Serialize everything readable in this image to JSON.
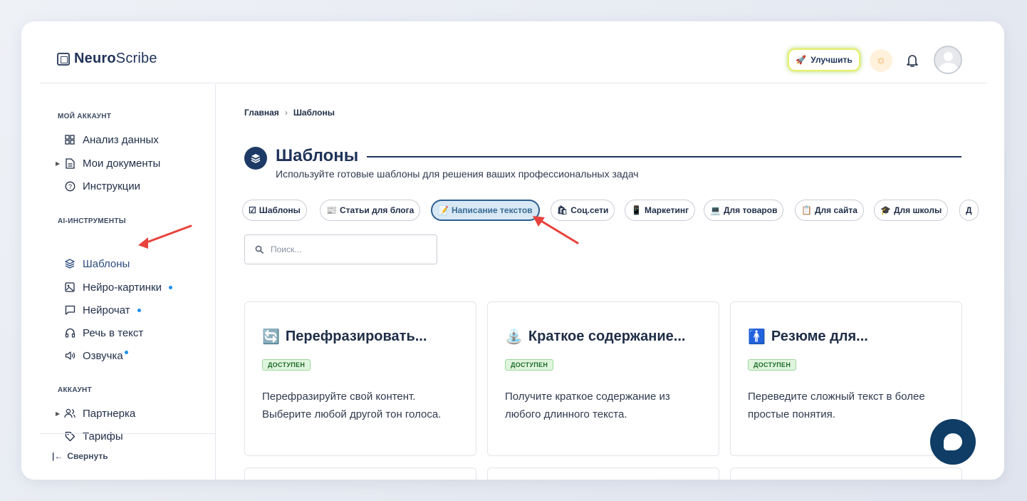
{
  "brand": {
    "name_bold": "Neuro",
    "name_rest": "Scribe"
  },
  "header": {
    "upgrade_label": "Улучшить"
  },
  "sidebar": {
    "sections": [
      {
        "title": "МОЙ АККАУНТ"
      },
      {
        "title": "AI-ИНСТРУМЕНТЫ"
      },
      {
        "title": "АККАУНТ"
      }
    ],
    "items": [
      {
        "label": "Анализ данных",
        "icon": "grid-icon"
      },
      {
        "label": "Мои документы",
        "icon": "document-icon"
      },
      {
        "label": "Инструкции",
        "icon": "help-circle-icon"
      },
      {
        "label": "Шаблоны",
        "icon": "layers-icon"
      },
      {
        "label": "Нейро-картинки",
        "icon": "image-icon"
      },
      {
        "label": "Нейрочат",
        "icon": "chat-icon"
      },
      {
        "label": "Речь в текст",
        "icon": "headphones-icon"
      },
      {
        "label": "Озвучка",
        "icon": "speaker-icon"
      },
      {
        "label": "Партнерка",
        "icon": "users-icon"
      },
      {
        "label": "Тарифы",
        "icon": "tag-icon"
      }
    ],
    "collapse_label": "Свернуть"
  },
  "breadcrumb": {
    "home": "Главная",
    "current": "Шаблоны"
  },
  "page": {
    "title": "Шаблоны",
    "subtitle": "Используйте готовые шаблоны для решения ваших профессиональных задач"
  },
  "chips": [
    {
      "emoji": "☑",
      "label": "Шаблоны"
    },
    {
      "emoji": "📰",
      "label": "Статьи для блога"
    },
    {
      "emoji": "📝",
      "label": "Написание текстов"
    },
    {
      "emoji": "🛍",
      "label": "Соц.сети"
    },
    {
      "emoji": "📱",
      "label": "Маркетинг"
    },
    {
      "emoji": "💻",
      "label": "Для товаров"
    },
    {
      "emoji": "📋",
      "label": "Для сайта"
    },
    {
      "emoji": "🎓",
      "label": "Для школы"
    },
    {
      "emoji": "",
      "label": "Д"
    }
  ],
  "search": {
    "placeholder": "Поиск..."
  },
  "cards": [
    {
      "icon": "🔄",
      "title": "Перефразировать...",
      "badge": "ДОСТУПЕН",
      "desc": "Перефразируйте свой контент. Выберите любой другой тон голоса."
    },
    {
      "icon": "⛲",
      "title": "Краткое содержание...",
      "badge": "ДОСТУПЕН",
      "desc": "Получите краткое содержание из любого длинного текста."
    },
    {
      "icon": "🚹",
      "title": "Резюме для...",
      "badge": "ДОСТУПЕН",
      "desc": "Переведите сложный текст в более простые понятия."
    }
  ],
  "colors": {
    "brand": "#1f3358",
    "active_chip_bg": "#d8e8f5",
    "dot": "#1e8ef0",
    "badge_bg": "#dff5dd",
    "annotation_arrow": "#e8423c"
  }
}
